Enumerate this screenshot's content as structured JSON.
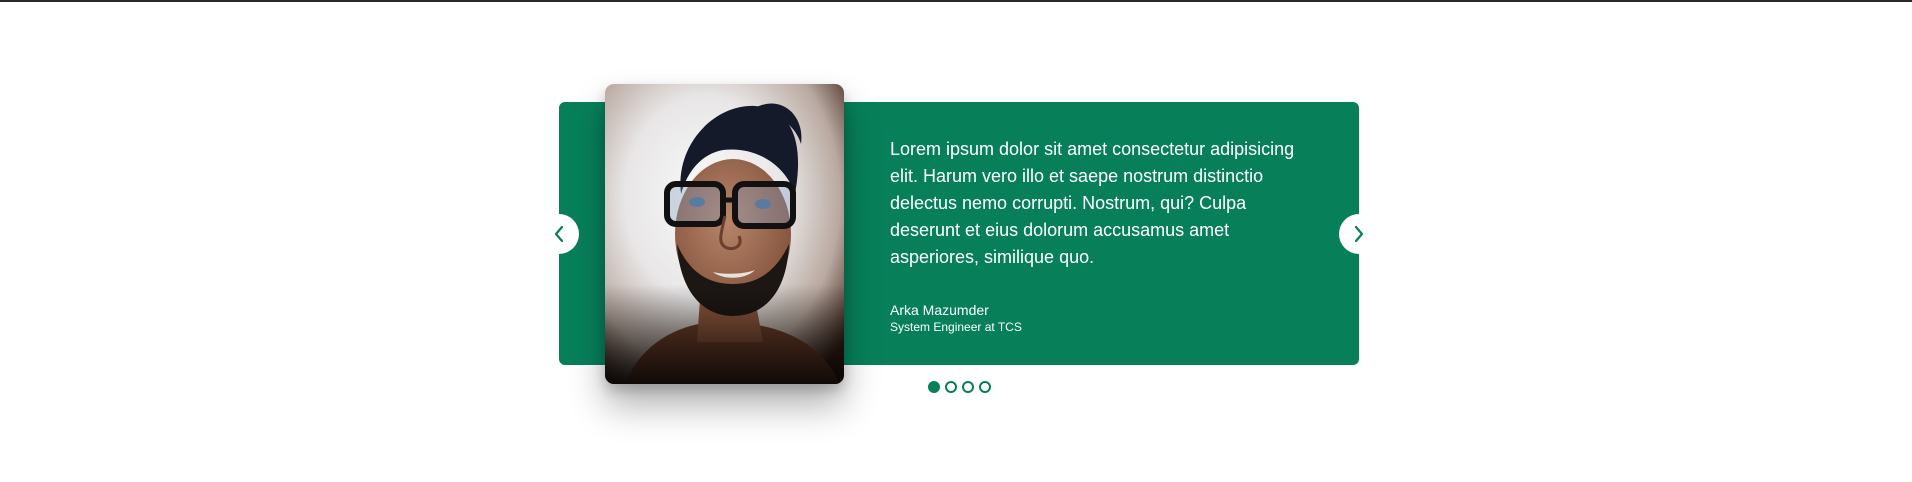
{
  "testimonial": {
    "quote": "Lorem ipsum dolor sit amet consectetur adipisicing elit. Harum vero illo et saepe nostrum distinctio delectus nemo corrupti. Nostrum, qui? Culpa deserunt et eius dolorum accusamus amet asperiores, similique quo.",
    "author": "Arka Mazumder",
    "role": "System Engineer at TCS"
  },
  "controls": {
    "prev_icon": "chevron-left-icon",
    "next_icon": "chevron-right-icon"
  },
  "pagination": {
    "total": 4,
    "active_index": 0
  },
  "colors": {
    "accent": "#07805a",
    "text_on_accent": "#ffffff",
    "page_background": "#ffffff"
  }
}
